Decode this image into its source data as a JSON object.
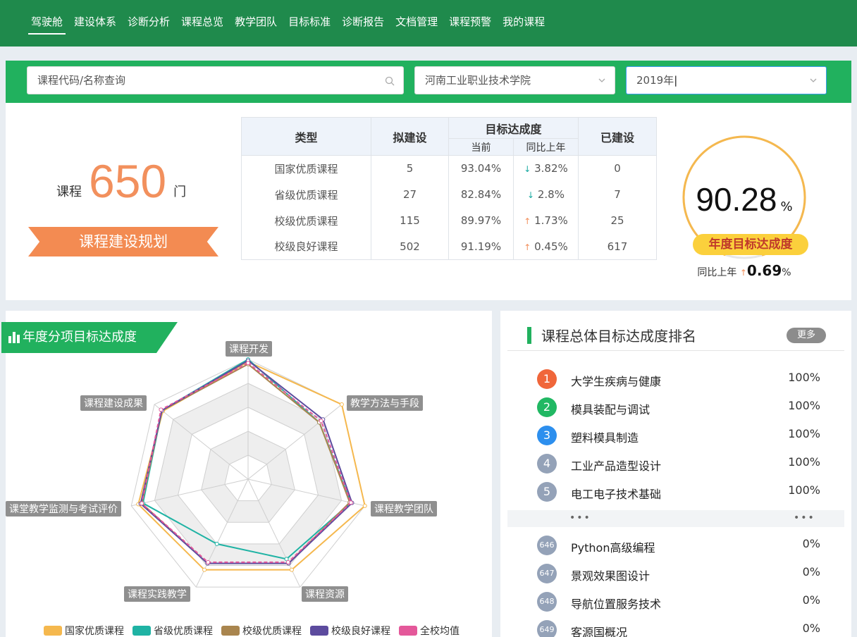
{
  "nav": {
    "items": [
      "驾驶舱",
      "建设体系",
      "诊断分析",
      "课程总览",
      "教学团队",
      "目标标准",
      "诊断报告",
      "文档管理",
      "课程预警",
      "我的课程"
    ]
  },
  "filters": {
    "search_placeholder": "课程代码/名称查询",
    "school": "河南工业职业技术学院",
    "year": "2019年"
  },
  "summary": {
    "prefix": "课程",
    "total": "650",
    "suffix": "门",
    "plan_button": "课程建设规划"
  },
  "table": {
    "headers": {
      "type": "类型",
      "planned": "拟建设",
      "target": "目标达成度",
      "current": "当前",
      "yoy": "同比上年",
      "built": "已建设"
    },
    "rows": [
      {
        "type": "国家优质课程",
        "planned": "5",
        "current": "93.04%",
        "dir": "down",
        "yoy": "3.82%",
        "built": "0"
      },
      {
        "type": "省级优质课程",
        "planned": "27",
        "current": "82.84%",
        "dir": "down",
        "yoy": "2.8%",
        "built": "7"
      },
      {
        "type": "校级优质课程",
        "planned": "115",
        "current": "89.97%",
        "dir": "up",
        "yoy": "1.73%",
        "built": "25"
      },
      {
        "type": "校级良好课程",
        "planned": "502",
        "current": "91.19%",
        "dir": "up",
        "yoy": "0.45%",
        "built": "617"
      }
    ]
  },
  "gauge": {
    "value": "90.28",
    "unit": "%",
    "label": "年度目标达成度",
    "yoy_label": "同比上年",
    "yoy_value": "0.69",
    "yoy_unit": "%",
    "percent": 90.28,
    "color": "#f5b84e"
  },
  "radar": {
    "title": "年度分项目标达成度",
    "axes": [
      "课程开发",
      "教学方法与手段",
      "课程教学团队",
      "课程资源",
      "课程实践教学",
      "课堂教学监测与考试评价",
      "课程建设成果"
    ],
    "series": [
      {
        "name": "国家优质课程",
        "color": "#f5b84e",
        "values": [
          98,
          100,
          100,
          84,
          84,
          94,
          91
        ]
      },
      {
        "name": "省级优质课程",
        "color": "#1fb3a4",
        "values": [
          100,
          76,
          88,
          74,
          60,
          90,
          92
        ]
      },
      {
        "name": "校级优质课程",
        "color": "#a9854e",
        "values": [
          96,
          76,
          87,
          78,
          78,
          91,
          92
        ]
      },
      {
        "name": "校级良好课程",
        "color": "#5c4b9e",
        "values": [
          99,
          80,
          89,
          78,
          78,
          92,
          92
        ]
      },
      {
        "name": "全校均值",
        "color": "#e4589a",
        "values": [
          97,
          78,
          88,
          77,
          77,
          91,
          93
        ]
      }
    ]
  },
  "ranking": {
    "title": "课程总体目标达成度排名",
    "more": "更多",
    "dots": "•••",
    "top": [
      {
        "rank": "1",
        "name": "大学生疾病与健康",
        "pct": "100%",
        "color": "#f0663a"
      },
      {
        "rank": "2",
        "name": "模具装配与调试",
        "pct": "100%",
        "color": "#21b863"
      },
      {
        "rank": "3",
        "name": "塑料模具制造",
        "pct": "100%",
        "color": "#2d8fee"
      },
      {
        "rank": "4",
        "name": "工业产品造型设计",
        "pct": "100%",
        "color": "#94a2b8"
      },
      {
        "rank": "5",
        "name": "电工电子技术基础",
        "pct": "100%",
        "color": "#94a2b8"
      }
    ],
    "bottom": [
      {
        "rank": "646",
        "name": "Python高级编程",
        "pct": "0%",
        "color": "#94a2b8"
      },
      {
        "rank": "647",
        "name": "景观效果图设计",
        "pct": "0%",
        "color": "#94a2b8"
      },
      {
        "rank": "648",
        "name": "导航位置服务技术",
        "pct": "0%",
        "color": "#94a2b8"
      },
      {
        "rank": "649",
        "name": "客源国概况",
        "pct": "0%",
        "color": "#94a2b8"
      }
    ]
  }
}
